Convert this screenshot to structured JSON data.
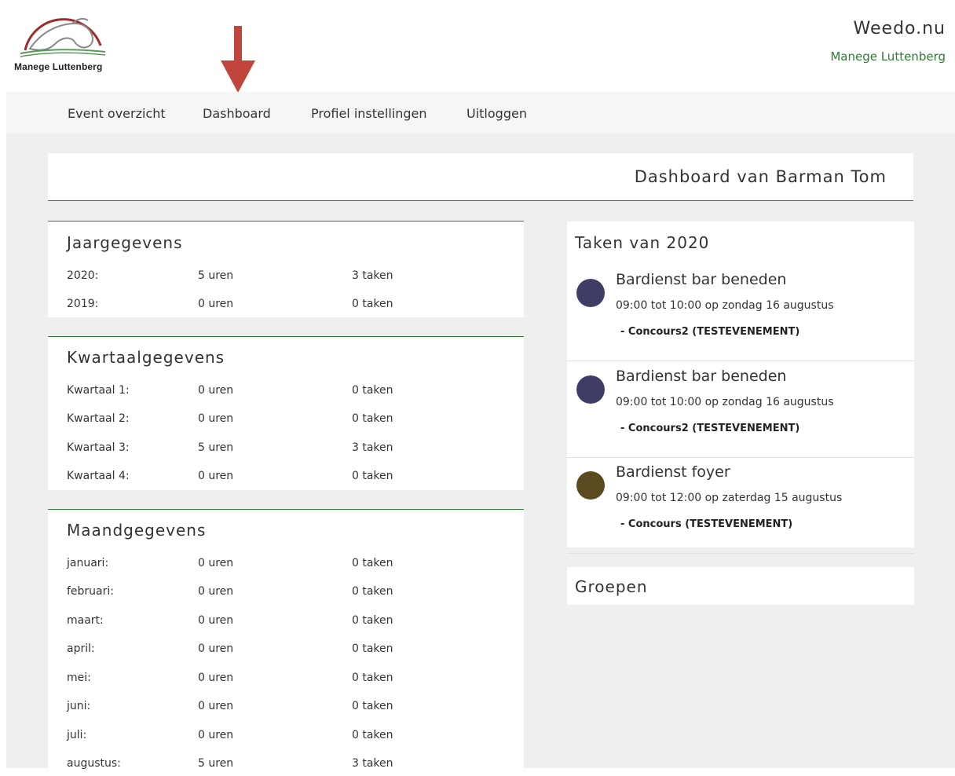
{
  "header": {
    "logo_text": "Manege Luttenberg",
    "brand_title": "Weedo.nu",
    "brand_subtitle": "Manege Luttenberg"
  },
  "nav": {
    "items": [
      {
        "label": "Event overzicht"
      },
      {
        "label": "Dashboard"
      },
      {
        "label": "Profiel instellingen"
      },
      {
        "label": "Uitloggen"
      }
    ]
  },
  "dashboard": {
    "title": "Dashboard van Barman Tom"
  },
  "jaar": {
    "title": "Jaargegevens",
    "rows": [
      {
        "label": "2020:",
        "hours": "5 uren",
        "tasks": "3 taken"
      },
      {
        "label": "2019:",
        "hours": "0 uren",
        "tasks": "0 taken"
      }
    ]
  },
  "kwartaal": {
    "title": "Kwartaalgegevens",
    "rows": [
      {
        "label": "Kwartaal 1:",
        "hours": "0 uren",
        "tasks": "0 taken"
      },
      {
        "label": "Kwartaal 2:",
        "hours": "0 uren",
        "tasks": "0 taken"
      },
      {
        "label": "Kwartaal 3:",
        "hours": "5 uren",
        "tasks": "3 taken"
      },
      {
        "label": "Kwartaal 4:",
        "hours": "0 uren",
        "tasks": "0 taken"
      }
    ]
  },
  "maand": {
    "title": "Maandgegevens",
    "rows": [
      {
        "label": "januari:",
        "hours": "0 uren",
        "tasks": "0 taken"
      },
      {
        "label": "februari:",
        "hours": "0 uren",
        "tasks": "0 taken"
      },
      {
        "label": "maart:",
        "hours": "0 uren",
        "tasks": "0 taken"
      },
      {
        "label": "april:",
        "hours": "0 uren",
        "tasks": "0 taken"
      },
      {
        "label": "mei:",
        "hours": "0 uren",
        "tasks": "0 taken"
      },
      {
        "label": "juni:",
        "hours": "0 uren",
        "tasks": "0 taken"
      },
      {
        "label": "juli:",
        "hours": "0 uren",
        "tasks": "0 taken"
      },
      {
        "label": "augustus:",
        "hours": "5 uren",
        "tasks": "3 taken"
      }
    ]
  },
  "taken": {
    "title": "Taken van 2020",
    "items": [
      {
        "title": "Bardienst bar beneden",
        "time": "09:00 tot 10:00 op zondag 16 augustus",
        "event": "-  Concours2 (TESTEVENEMENT)",
        "color": "#3e3d66"
      },
      {
        "title": "Bardienst bar beneden",
        "time": "09:00 tot 10:00 op zondag 16 augustus",
        "event": "-  Concours2 (TESTEVENEMENT)",
        "color": "#3e3d66"
      },
      {
        "title": "Bardienst foyer",
        "time": "09:00 tot 12:00 op zaterdag 15 augustus",
        "event": "-  Concours (TESTEVENEMENT)",
        "color": "#5b4a1f"
      }
    ]
  },
  "groepen": {
    "title": "Groepen"
  },
  "colors": {
    "accent": "#2e7d32",
    "arrow": "#c0453a",
    "logo_arc": "#9e2a2b"
  }
}
